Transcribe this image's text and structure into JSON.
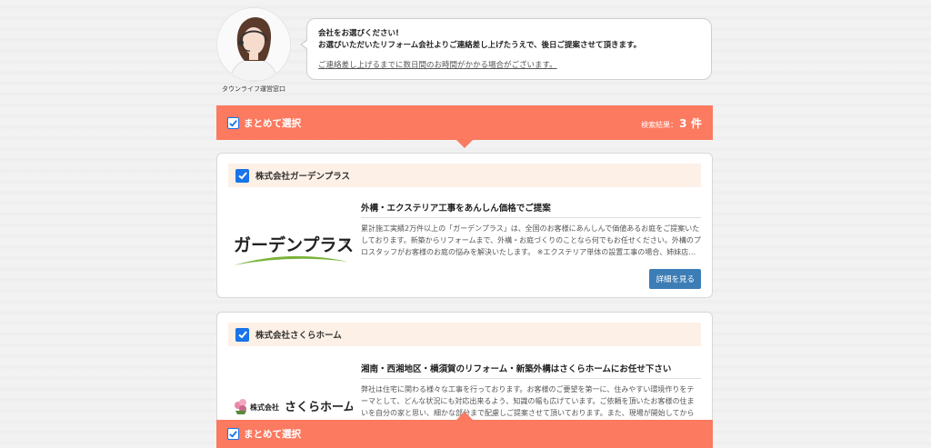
{
  "operator": {
    "caption": "タウンライフ運営窓口",
    "message_line1": "会社をお選びください!",
    "message_line2": "お選びいただいたリフォーム会社よりご連絡差し上げたうえで、後日ご提案させて頂きます。",
    "message_note": "ご連絡差し上げるまでに数日間のお時間がかかる場合がございます。"
  },
  "select_all_bar": {
    "label": "まとめて選択",
    "result_label": "検索結果：",
    "result_count": "3",
    "result_unit": "件"
  },
  "companies": [
    {
      "name": "株式会社ガーデンプラス",
      "logo_text": "ガーデンプラス",
      "logo_mark": "®",
      "title": "外構・エクステリア工事をあんしん価格でご提案",
      "description": "累計施工実績2万件以上の「ガーデンプラス」は、全国のお客様にあんしんで価値あるお庭をご提案いたしております。新築からリフォームまで、外構・お庭づくりのことなら何でもお任せください。外構のプロスタッフがお客様のお庭の悩みを解決いたします。 ※エクステリア単体の設置工事の場合、姉妹店…",
      "detail_button": "詳細を見る",
      "selected": true
    },
    {
      "name": "株式会社さくらホーム",
      "logo_text_small": "株式会社",
      "logo_text": "さくらホーム",
      "title": "湘南・西湘地区・横須賀のリフォーム・新築外構はさくらホームにお任せ下さい",
      "description": "弊社は住宅に関わる様々な工事を行っております。お客様のご要望を第一に、住みやすい環境作りをテーマとして、どんな状況にも対応出来るよう、知識の幅も広げています。ご依頼を頂いたお客様の住まいを自分の家と思い、細かな部分まで配慮しご提案させて頂いております。また、現場が開始してからの…",
      "selected": true
    }
  ],
  "colors": {
    "accent": "#fb7a60",
    "checkbox": "#1a73e8",
    "card_header": "#fdf0e6",
    "button": "#3d7db5",
    "logo_green": "#7bb33a"
  }
}
